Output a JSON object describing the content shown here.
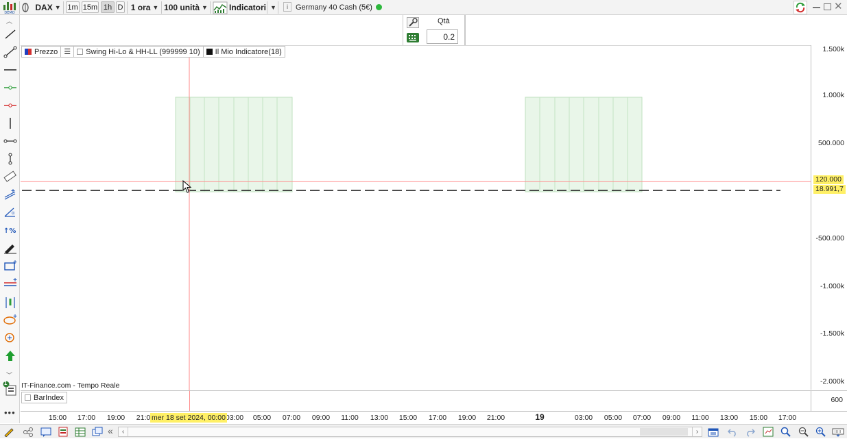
{
  "toolbar": {
    "instrument": "DAX",
    "timeframes": [
      "1m",
      "15m",
      "1h",
      "D"
    ],
    "active_timeframe": "1h",
    "period": "1 ora",
    "units": "100 unità",
    "indicators_label": "Indicatori",
    "info_symbol": "i",
    "market_name": "Germany 40 Cash (5€)",
    "status_color": "#2db83d"
  },
  "order": {
    "qty_label": "Qtà",
    "qty_value": "0.2"
  },
  "legend": {
    "price": "Prezzo",
    "swing": "Swing Hi-Lo & HH-LL (999999 10)",
    "custom": "Il Mio Indicatore(18)"
  },
  "chart": {
    "source": "IT-Finance.com - Tempo Reale",
    "y_ticks": [
      "1.500k",
      "1.000k",
      "500.000",
      "-500.000",
      "-1.000k",
      "-1.500k",
      "-2.000k"
    ],
    "crosshair_value": "120.000",
    "last_price": "18.991,7",
    "accent_yellow": "#fff066",
    "crosshair_color": "#ff8a8a"
  },
  "lower_pane": {
    "label": "BarIndex",
    "y_tick": "600"
  },
  "time_axis": {
    "labels": [
      "15:00",
      "17:00",
      "19:00",
      "21:0",
      "03:00",
      "05:00",
      "07:00",
      "09:00",
      "11:00",
      "13:00",
      "15:00",
      "17:00",
      "19:00",
      "21:00",
      "19",
      "03:00",
      "05:00",
      "07:00",
      "09:00",
      "11:00",
      "13:00",
      "15:00",
      "17:00"
    ],
    "crosshair_date": "mer 18 set 2024, 00:00"
  },
  "left_tools": [
    "line-icon",
    "segment-icon",
    "horizontal-line-icon",
    "buy-line-icon",
    "sell-line-icon",
    "vertical-line-icon",
    "horizontal-segment-icon",
    "vertical-segment-icon",
    "ruler-icon",
    "trend-channel-icon",
    "angle-icon",
    "percent-icon",
    "pencil-icon",
    "rectangle-icon",
    "parallel-lines-icon",
    "vertical-range-icon",
    "ellipse-icon",
    "circle-icon",
    "up-arrow-icon"
  ],
  "left_tools_badge": "1"
}
